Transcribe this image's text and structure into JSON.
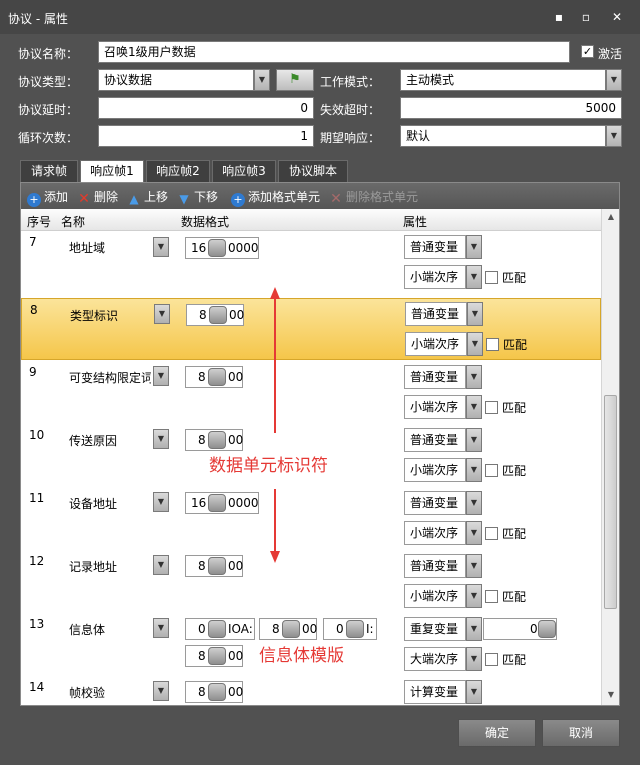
{
  "window": {
    "title": "协议 - 属性"
  },
  "form": {
    "protocol_name_label": "协议名称：",
    "protocol_name_value": "召唤1级用户数据",
    "activate_label": "激活",
    "protocol_type_label": "协议类型：",
    "protocol_type_value": "协议数据",
    "work_mode_label": "工作模式：",
    "work_mode_value": "主动模式",
    "delay_label": "协议延时：",
    "delay_value": "0",
    "timeout_label": "失效超时：",
    "timeout_value": "5000",
    "loop_label": "循环次数：",
    "loop_value": "1",
    "expect_label": "期望响应：",
    "expect_value": "默认"
  },
  "tabs": [
    "请求帧",
    "响应帧1",
    "响应帧2",
    "响应帧3",
    "协议脚本"
  ],
  "toolbar": {
    "add": "添加",
    "delete": "删除",
    "up": "上移",
    "down": "下移",
    "add_format_unit": "添加格式单元",
    "delete_format_unit": "删除格式单元"
  },
  "grid": {
    "headers": {
      "num": "序号",
      "name": "名称",
      "format": "数据格式",
      "attr": "属性"
    },
    "rows": [
      {
        "num": "7",
        "name": "地址域",
        "fmt_a": "16",
        "fmt_b": "0000",
        "attr1": "普通变量",
        "attr2": "小端次序",
        "match": "匹配"
      },
      {
        "num": "8",
        "name": "类型标识",
        "fmt_a": "8",
        "fmt_b": "00",
        "attr1": "普通变量",
        "attr2": "小端次序",
        "match": "匹配"
      },
      {
        "num": "9",
        "name": "可变结构限定词",
        "fmt_a": "8",
        "fmt_b": "00",
        "attr1": "普通变量",
        "attr2": "小端次序",
        "match": "匹配"
      },
      {
        "num": "10",
        "name": "传送原因",
        "fmt_a": "8",
        "fmt_b": "00",
        "attr1": "普通变量",
        "attr2": "小端次序",
        "match": "匹配"
      },
      {
        "num": "11",
        "name": "设备地址",
        "fmt_a": "16",
        "fmt_b": "0000",
        "attr1": "普通变量",
        "attr2": "小端次序",
        "match": "匹配"
      },
      {
        "num": "12",
        "name": "记录地址",
        "fmt_a": "8",
        "fmt_b": "00",
        "attr1": "普通变量",
        "attr2": "小端次序",
        "match": "匹配"
      },
      {
        "num": "13",
        "name": "信息体",
        "fmt_a": "0",
        "fmt_b": "IOA:",
        "fmt_c": "8",
        "fmt_d": "00",
        "fmt_e": "0",
        "fmt_f": "I:",
        "fmt_g": "8",
        "fmt_h": "00",
        "attr1": "重复变量",
        "attr1_value": "0",
        "attr2": "大端次序",
        "match": "匹配"
      },
      {
        "num": "14",
        "name": "帧校验",
        "fmt_a": "8",
        "fmt_b": "00",
        "attr1": "计算变量"
      }
    ]
  },
  "annotations": {
    "data_unit_id": "数据单元标识符",
    "info_template": "信息体模版"
  },
  "buttons": {
    "ok": "确定",
    "cancel": "取消"
  }
}
